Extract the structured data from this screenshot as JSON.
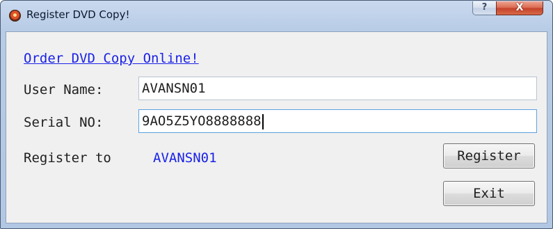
{
  "window": {
    "title": "Register DVD Copy!",
    "help_label": "?",
    "close_label": "X"
  },
  "form": {
    "order_link": "Order DVD Copy Online!",
    "username_label": "User Name:",
    "username_value": "AVANSN01",
    "serial_label": "Serial NO:",
    "serial_value": "9AO5Z5YO8888888",
    "register_to_label": "Register to",
    "register_to_value": "AVANSN01"
  },
  "buttons": {
    "register_label": "Register",
    "exit_label": "Exit"
  },
  "colors": {
    "link": "#1a22e6",
    "title_bar": "#b7cbe6",
    "close_button": "#c5402a",
    "client_background": "#f0f0f0"
  },
  "icons": {
    "app": "dvd-copy-app-icon",
    "help": "help-icon",
    "close": "close-icon"
  }
}
